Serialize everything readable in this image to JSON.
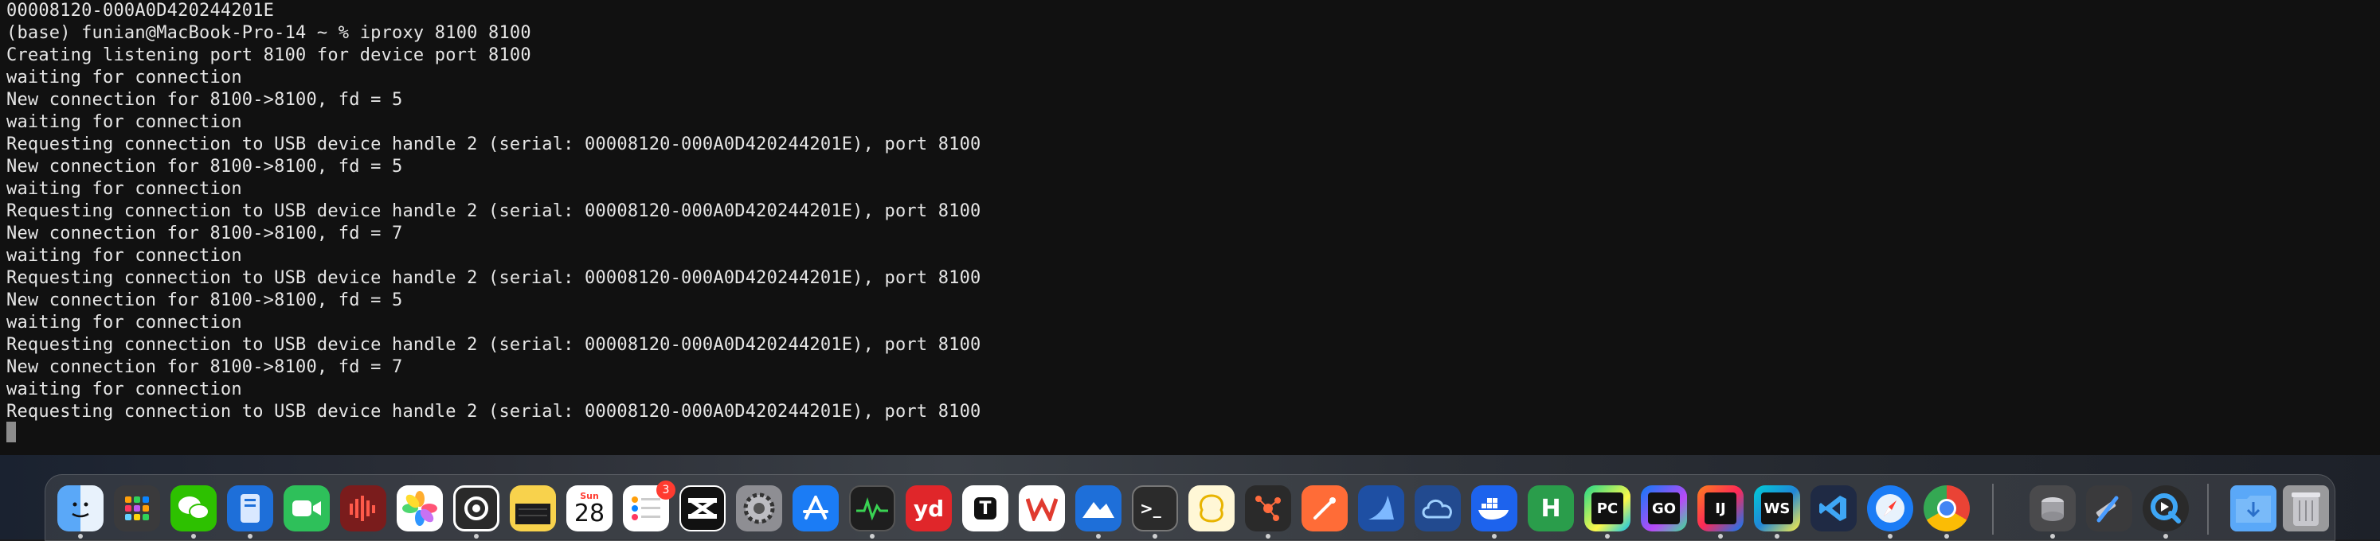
{
  "terminal": {
    "lines": [
      "00008120-000A0D420244201E",
      "(base) funian@MacBook-Pro-14 ~ % iproxy 8100 8100",
      "Creating listening port 8100 for device port 8100",
      "waiting for connection",
      "New connection for 8100->8100, fd = 5",
      "waiting for connection",
      "Requesting connection to USB device handle 2 (serial: 00008120-000A0D420244201E), port 8100",
      "New connection for 8100->8100, fd = 5",
      "waiting for connection",
      "Requesting connection to USB device handle 2 (serial: 00008120-000A0D420244201E), port 8100",
      "New connection for 8100->8100, fd = 7",
      "waiting for connection",
      "Requesting connection to USB device handle 2 (serial: 00008120-000A0D420244201E), port 8100",
      "New connection for 8100->8100, fd = 5",
      "waiting for connection",
      "Requesting connection to USB device handle 2 (serial: 00008120-000A0D420244201E), port 8100",
      "New connection for 8100->8100, fd = 7",
      "waiting for connection",
      "Requesting connection to USB device handle 2 (serial: 00008120-000A0D420244201E), port 8100"
    ]
  },
  "dock": {
    "calendar": {
      "month": "Sun",
      "day": "28"
    },
    "reminders_badge": "3",
    "youdao_label": "yd",
    "typora_label": "T",
    "hbuilder_label": "H",
    "pycharm_label": "PC",
    "goland_label": "GO",
    "idea_label": "IJ",
    "webstorm_label": "WS",
    "terminal_label": ">_",
    "icons": [
      "finder-icon",
      "launchpad-icon",
      "wechat-icon",
      "files-icon",
      "facetime-icon",
      "sound-icon",
      "photos-icon",
      "loop-icon",
      "notes-icon",
      "calendar-icon",
      "reminders-icon",
      "capcut-icon",
      "settings-icon",
      "app-store-icon",
      "activity-monitor-icon",
      "youdao-icon",
      "typora-icon",
      "wps-icon",
      "lark-icon",
      "terminal-icon",
      "navicat-icon",
      "xmind-icon",
      "postman-icon",
      "wireshark-icon",
      "cloud-icon",
      "docker-icon",
      "hbuilder-icon",
      "pycharm-icon",
      "goland-icon",
      "intellij-idea-icon",
      "webstorm-icon",
      "vscode-icon",
      "safari-icon",
      "chrome-icon",
      "disk-utility-icon",
      "xcode-icon",
      "quicktime-icon",
      "downloads-folder-icon",
      "trash-icon"
    ]
  }
}
